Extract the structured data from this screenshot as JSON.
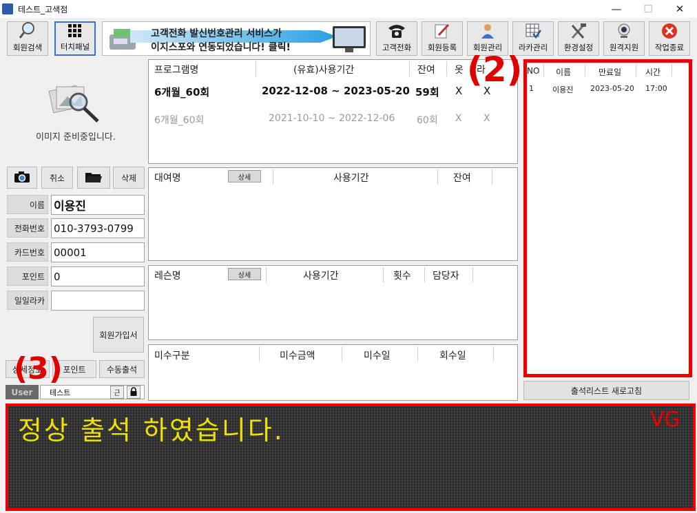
{
  "window": {
    "title": "테스트_고색점",
    "controls": {
      "minimize": "—",
      "maximize": "☐",
      "close": "✕"
    }
  },
  "toolbar": {
    "left_buttons": [
      {
        "label": "회원검색",
        "icon": "search-icon"
      },
      {
        "label": "터치패널",
        "icon": "grid-icon"
      }
    ],
    "banner": {
      "line1": "고객전화 발신번호관리 서비스가",
      "line2": "이지스포와 연동되었습니다!",
      "click": "클릭!"
    },
    "right_buttons": [
      {
        "label": "고객전화",
        "icon": "phone-icon"
      },
      {
        "label": "회원등록",
        "icon": "edit-icon"
      },
      {
        "label": "회원관리",
        "icon": "user-icon"
      },
      {
        "label": "라카관리",
        "icon": "locker-grid-icon"
      },
      {
        "label": "환경설정",
        "icon": "tools-icon"
      },
      {
        "label": "원격지원",
        "icon": "webcam-icon"
      },
      {
        "label": "작업종료",
        "icon": "exit-icon"
      }
    ]
  },
  "member": {
    "photo_caption": "이미지 준비중입니다.",
    "photo_buttons": {
      "cancel": "취소",
      "delete": "삭제"
    },
    "fields": [
      {
        "label": "이름",
        "value": "이용진"
      },
      {
        "label": "전화번호",
        "value": "010-3793-0799"
      },
      {
        "label": "카드번호",
        "value": "00001"
      },
      {
        "label": "포인트",
        "value": "0"
      },
      {
        "label": "일일라카",
        "value": ""
      }
    ],
    "join_button": "회원가입서",
    "bottom_buttons": [
      "상세정보",
      "포인트",
      "수동출석"
    ],
    "user_tag": "User",
    "user_name": "테스트",
    "user_mini_btn": "근"
  },
  "programs": {
    "headers": [
      "프로그램명",
      "(유효)사용기간",
      "잔여",
      "옷",
      "라"
    ],
    "rows": [
      {
        "name": "6개월_60회",
        "period": "2022-12-08 ~ 2023-05-20",
        "remain": "59회",
        "cloth": "X",
        "locker": "X",
        "active": true
      },
      {
        "name": "6개월_60회",
        "period": "2021-10-10 ~ 2022-12-06",
        "remain": "60회",
        "cloth": "X",
        "locker": "X",
        "active": false
      }
    ]
  },
  "rentals": {
    "headers": [
      "대여명",
      "사용기간",
      "잔여"
    ],
    "detail": "상세"
  },
  "lessons": {
    "headers": [
      "레슨명",
      "사용기간",
      "횟수",
      "담당자"
    ],
    "detail": "상세"
  },
  "unpaid": {
    "headers": [
      "미수구분",
      "미수금액",
      "미수일",
      "회수일"
    ]
  },
  "attendance": {
    "headers": [
      "NO",
      "이름",
      "만료일",
      "시간"
    ],
    "rows": [
      {
        "no": "1",
        "name": "이용진",
        "expiry": "2023-05-20",
        "time": "17:00"
      }
    ],
    "refresh_button": "출석리스트 새로고침"
  },
  "annotations": {
    "a2": "(2)",
    "a3": "(3)"
  },
  "status": {
    "message": "정상 출석 하였습니다.",
    "tag": "VG"
  },
  "colors": {
    "annotation": "#ee0000",
    "led_text": "#f0e000",
    "led_bg": "#3a3a3a"
  }
}
